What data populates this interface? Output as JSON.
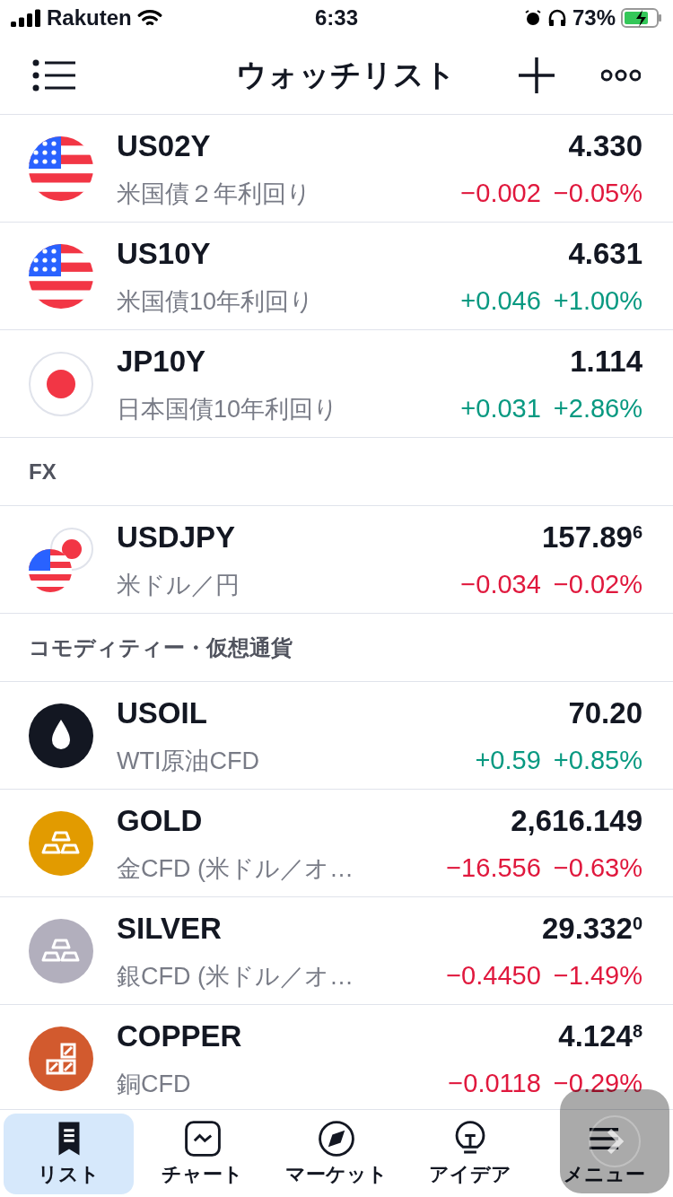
{
  "status_bar": {
    "carrier": "Rakuten",
    "time": "6:33",
    "battery": "73%"
  },
  "header": {
    "title": "ウォッチリスト"
  },
  "sections": [
    {
      "rows": [
        {
          "kind": "us",
          "symbol": "US02Y",
          "name": "米国債２年利回り",
          "price": "4.330",
          "change": "−0.002",
          "percent": "−0.05%",
          "rising": false
        },
        {
          "kind": "us",
          "symbol": "US10Y",
          "name": "米国債10年利回り",
          "price": "4.631",
          "change": "+0.046",
          "percent": "+1.00%",
          "rising": true
        },
        {
          "kind": "jp",
          "symbol": "JP10Y",
          "name": "日本国債10年利回り",
          "price": "1.114",
          "change": "+0.031",
          "percent": "+2.86%",
          "rising": true
        }
      ]
    },
    {
      "title": "FX",
      "rows": [
        {
          "kind": "usjp",
          "symbol": "USDJPY",
          "name": "米ドル／円",
          "price": "157.89$^{6}$",
          "change": "−0.034",
          "percent": "−0.02%",
          "rising": false
        }
      ]
    },
    {
      "title": "コモディティー・仮想通貨",
      "rows": [
        {
          "kind": "drop",
          "symbol": "USOIL",
          "name": "WTI原油CFD",
          "price": "70.20",
          "change": "+0.59",
          "percent": "+0.85%",
          "rising": true,
          "color": "#131722"
        },
        {
          "kind": "bars",
          "symbol": "GOLD",
          "name": "金CFD (米ドル／オ…",
          "price": "2,616.149",
          "change": "−16.556",
          "percent": "−0.63%",
          "rising": false,
          "color": "#e29b00"
        },
        {
          "kind": "bars",
          "symbol": "SILVER",
          "name": "銀CFD (米ドル／オ…",
          "price": "29.332$^{0}$",
          "change": "−0.4450",
          "percent": "−1.49%",
          "rising": false,
          "color": "#b2afbd"
        },
        {
          "kind": "blocks",
          "symbol": "COPPER",
          "name": "銅CFD",
          "price": "4.124$^{8}$",
          "change": "−0.0118",
          "percent": "−0.29%",
          "rising": false,
          "color": "#d25a2e"
        }
      ]
    }
  ],
  "tabs": [
    {
      "kind": "list",
      "label": "リスト",
      "selected": true
    },
    {
      "kind": "chart",
      "label": "チャート",
      "selected": false
    },
    {
      "kind": "compass",
      "label": "マーケット",
      "selected": false
    },
    {
      "kind": "bulb",
      "label": "アイデア",
      "selected": false
    },
    {
      "kind": "menu",
      "label": "メニュー",
      "selected": false
    }
  ]
}
